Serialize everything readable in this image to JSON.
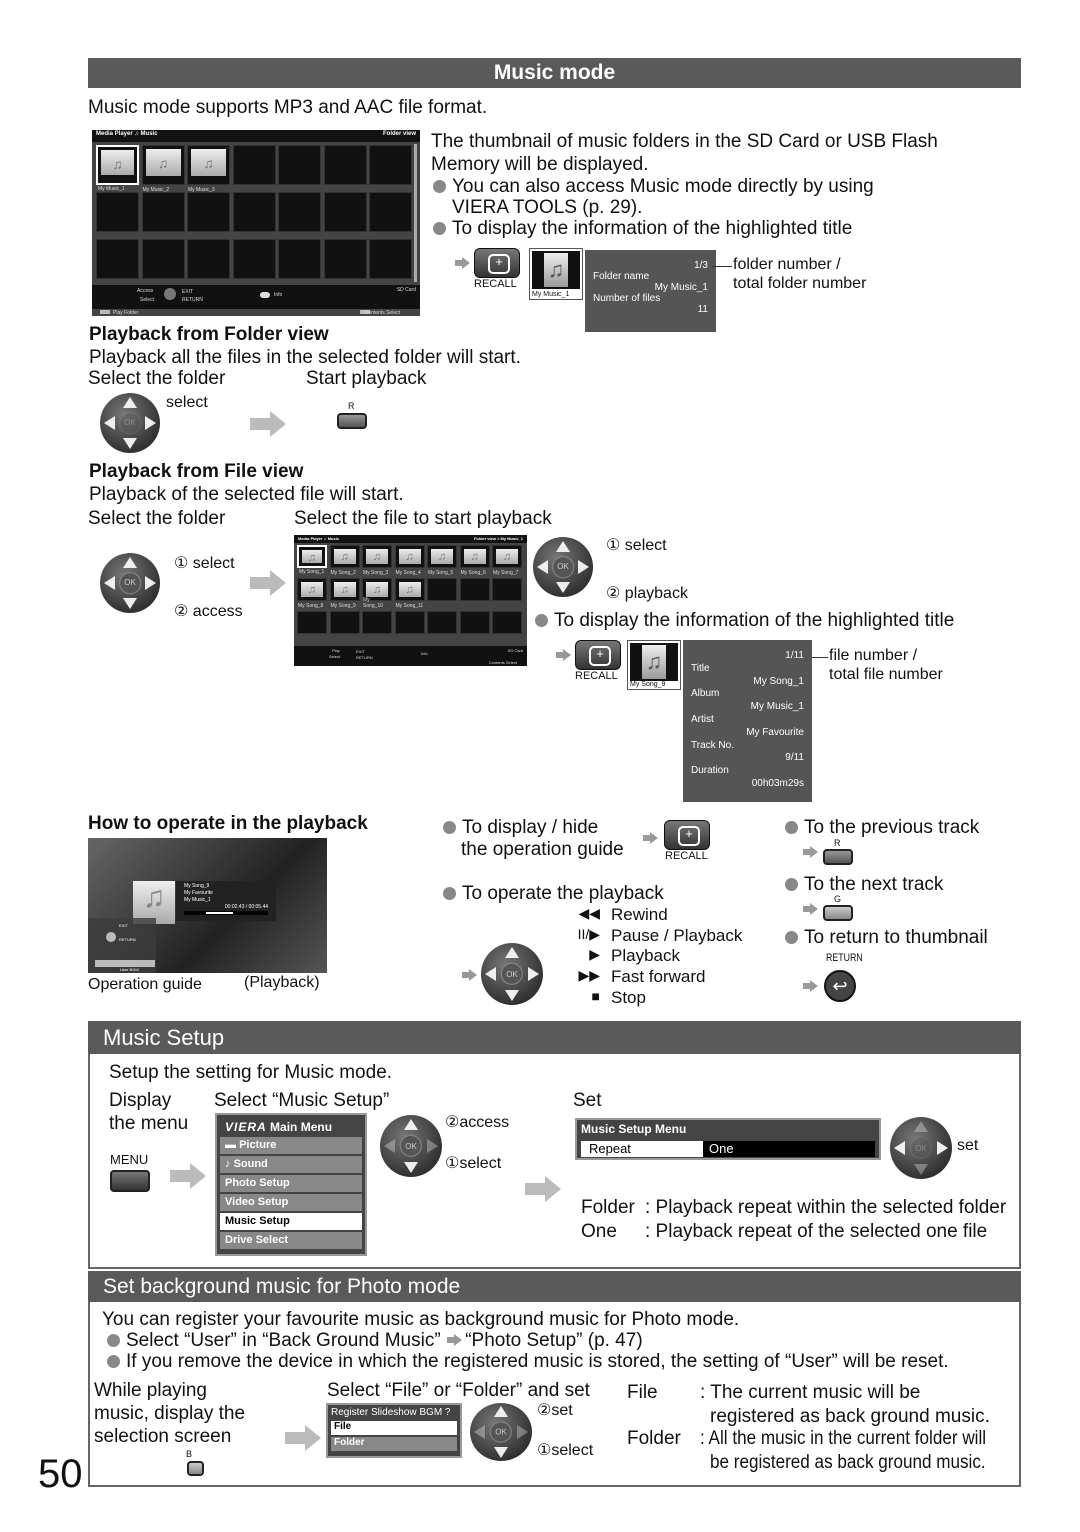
{
  "page_number": "50",
  "remote": {
    "ok": "OK",
    "recall": "RECALL",
    "r": "R",
    "g": "G",
    "b": "B",
    "menu": "MENU",
    "return": "RETURN"
  },
  "music_mode": {
    "header": "Music mode",
    "intro": "Music mode supports MP3 and AAC file format.",
    "folder_screen": {
      "title": "Media Player",
      "mode": "Music",
      "view": "Folder view",
      "folders": [
        "My Music_1",
        "My Music_2",
        "My Music_3"
      ],
      "access": "Access",
      "select": "Select",
      "exit": "EXIT",
      "return": "RETURN",
      "info": "Info",
      "source": "SD Card",
      "footer_play": "Play Folder",
      "footer_contents": "Contents Select"
    },
    "desc": [
      "The thumbnail of music folders in the SD Card or USB Flash",
      "Memory will be displayed."
    ],
    "bullets": [
      "You can also access Music mode directly by using",
      "VIERA TOOLS (p. 29).",
      "To display the information of the highlighted title"
    ],
    "folder_info": {
      "thumb_caption": "My Music_1",
      "count": "1/3",
      "name_label": "Folder name",
      "name": "My Music_1",
      "files_label": "Number of files",
      "files": "11",
      "annot1": "folder number /",
      "annot2": "total folder number"
    },
    "folder_playback": {
      "heading": "Playback from Folder view",
      "text": "Playback all the files in the selected folder will start.",
      "step1": "Select the folder",
      "step2": "Start playback",
      "select": "select"
    },
    "file_playback": {
      "heading": "Playback from File view",
      "text": "Playback of the selected file will start.",
      "step1": "Select the folder",
      "step2": "Select the file to start playback",
      "select1": "① select",
      "access": "② access",
      "select2": "① select",
      "playback": "② playback",
      "bullet": "To display the information of the highlighted title"
    },
    "file_screen": {
      "title": "Media Player",
      "mode": "Music",
      "view": "Folder view > My Music_1",
      "files": [
        "My Song_1",
        "My Song_2",
        "My Song_3",
        "My Song_4",
        "My Song_5",
        "My Song_6",
        "My Song_7",
        "My Song_8",
        "My Song_9",
        "My Song_10",
        "My Song_11"
      ],
      "play": "Play",
      "select": "Select",
      "exit": "EXIT",
      "return": "RETURN",
      "info": "Info",
      "source": "SD Card",
      "footer_contents": "Contents Select"
    },
    "file_info": {
      "thumb_caption": "My Song_9",
      "count": "1/11",
      "title_label": "Title",
      "title": "My Song_1",
      "album_label": "Album",
      "album": "My Music_1",
      "artist_label": "Artist",
      "artist": "My Favourite",
      "track_label": "Track No.",
      "track": "9/11",
      "duration_label": "Duration",
      "duration": "00h03m29s",
      "annot1": "file number /",
      "annot2": "total file number"
    },
    "operate": {
      "heading": "How to operate in the playback",
      "screen": {
        "song": "My Song_9",
        "artist": "My Favourite",
        "album": "My Music_1",
        "time": "00:02.43 / 00:05.44",
        "progress": 0.45,
        "exit": "EXIT",
        "return": "RETURN",
        "user_bgm": "User BGM"
      },
      "caption1": "Operation guide",
      "caption2": "(Playback)",
      "guide_line1": "To display / hide",
      "guide_line2": "the operation guide",
      "operate_bullet": "To operate the playback",
      "controls": [
        {
          "sym": "◀◀",
          "label": "Rewind"
        },
        {
          "sym": "II/▶",
          "label": "Pause / Playback"
        },
        {
          "sym": "▶",
          "label": "Playback"
        },
        {
          "sym": "▶▶",
          "label": "Fast forward"
        },
        {
          "sym": "■",
          "label": "Stop"
        }
      ],
      "prev": "To the previous track",
      "next": "To the next track",
      "back": "To return to thumbnail"
    }
  },
  "music_setup": {
    "header": "Music Setup",
    "intro": "Setup the setting for Music mode.",
    "display1": "Display",
    "display2": "the menu",
    "select_label": "Select “Music Setup”",
    "set_label": "Set",
    "main_menu": {
      "brand": "VIERA",
      "title": "Main Menu",
      "items": [
        "Picture",
        "Sound",
        "Photo Setup",
        "Video Setup",
        "Music Setup",
        "Drive Select"
      ],
      "selected": "Music Setup"
    },
    "access": "②access",
    "select": "①select",
    "set": "set",
    "setup_menu": {
      "title": "Music Setup Menu",
      "item": "Repeat",
      "value": "One"
    },
    "folder_term": "Folder",
    "folder_desc": ": Playback repeat within the selected folder",
    "one_term": "One",
    "one_desc": ": Playback repeat of the selected one file"
  },
  "bgm": {
    "header": "Set background music for Photo mode",
    "intro": "You can register your favourite music as background music for Photo mode.",
    "bullet1a": "Select “User” in “Back Ground Music”",
    "bullet1b": "“Photo Setup” (p. 47)",
    "bullet2": "If you remove the device in which the registered music is stored, the setting of “User” will be reset.",
    "step1": [
      "While playing",
      "music, display the",
      "selection screen"
    ],
    "step2": "Select “File” or “Folder” and set",
    "dialog": {
      "title": "Register Slideshow BGM ?",
      "options": [
        "File",
        "Folder"
      ],
      "selected": "File"
    },
    "set": "②set",
    "select": "①select",
    "file_term": "File",
    "file_desc1": ": The current music will be",
    "file_desc2": "registered as back ground music.",
    "folder_term": "Folder",
    "folder_desc1": ": All the music in the current folder will",
    "folder_desc2": "be registered as back ground music."
  }
}
